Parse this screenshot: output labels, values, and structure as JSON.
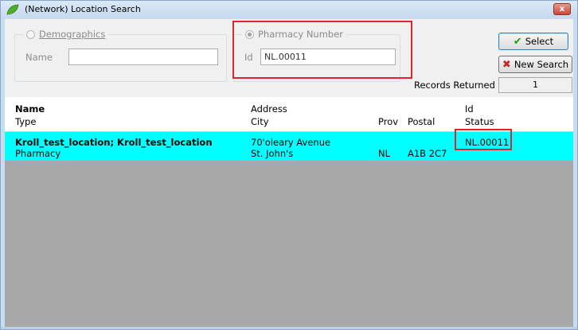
{
  "window": {
    "title": "(Network) Location Search",
    "close_label": "x"
  },
  "demographics": {
    "legend": "Demographics",
    "name_label": "Name",
    "name_value": ""
  },
  "pharmacy": {
    "legend": "Pharmacy Number",
    "id_label": "Id",
    "id_value": "NL.00011"
  },
  "buttons": {
    "select_label": "Select",
    "new_search_label": "New Search"
  },
  "records": {
    "label": "Records Returned",
    "value": "1"
  },
  "columns": {
    "name": "Name",
    "type": "Type",
    "address": "Address",
    "city": "City",
    "prov": "Prov",
    "postal": "Postal",
    "id": "Id",
    "status": "Status"
  },
  "rows": [
    {
      "name": "Kroll_test_location; Kroll_test_location",
      "type": "Pharmacy",
      "address": "70'oleary Avenue",
      "city": "St. John's",
      "prov": "NL",
      "postal": "A1B 2C7",
      "id": "NL.00011",
      "status": ""
    }
  ],
  "colors": {
    "selected_row": "#00ffff",
    "highlight": "#e0242e",
    "empty_area": "#a8a8a8"
  },
  "icons": {
    "app": "leaf-icon",
    "select": "checkmark-icon",
    "new_search": "red-x-icon"
  }
}
